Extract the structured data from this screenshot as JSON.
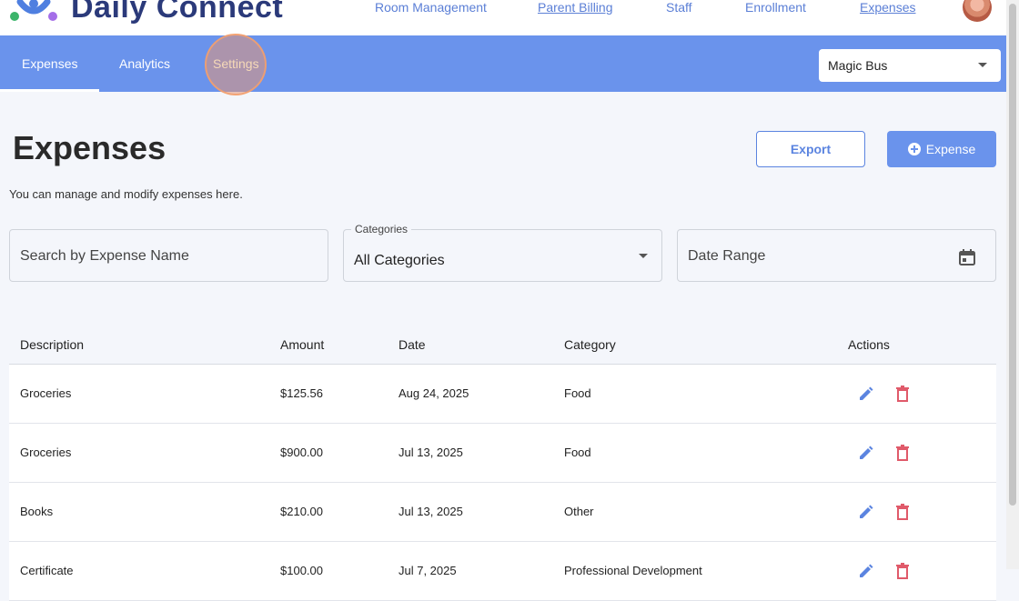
{
  "app": {
    "name": "Daily Connect"
  },
  "topnav": [
    {
      "label": "Room Management"
    },
    {
      "label": "Parent Billing"
    },
    {
      "label": "Staff"
    },
    {
      "label": "Enrollment"
    },
    {
      "label": "Expenses"
    }
  ],
  "tabs": [
    {
      "label": "Expenses"
    },
    {
      "label": "Analytics"
    },
    {
      "label": "Settings"
    }
  ],
  "org_select": {
    "value": "Magic Bus"
  },
  "page": {
    "title": "Expenses",
    "subtitle": "You can manage and modify expenses here.",
    "export_label": "Export",
    "add_label": "Expense"
  },
  "filters": {
    "search_placeholder": "Search by Expense Name",
    "categories_label": "Categories",
    "categories_value": "All Categories",
    "date_placeholder": "Date Range"
  },
  "table": {
    "headers": [
      "Description",
      "Amount",
      "Date",
      "Category",
      "Actions"
    ],
    "rows": [
      {
        "description": "Groceries",
        "amount": "$125.56",
        "date": "Aug 24, 2025",
        "category": "Food"
      },
      {
        "description": "Groceries",
        "amount": "$900.00",
        "date": "Jul 13, 2025",
        "category": "Food"
      },
      {
        "description": "Books",
        "amount": "$210.00",
        "date": "Jul 13, 2025",
        "category": "Other"
      },
      {
        "description": "Certificate",
        "amount": "$100.00",
        "date": "Jul 7, 2025",
        "category": "Professional Development"
      }
    ]
  },
  "colors": {
    "accent": "#6a93ec",
    "edit": "#5b84e0",
    "delete": "#e05a6a"
  }
}
